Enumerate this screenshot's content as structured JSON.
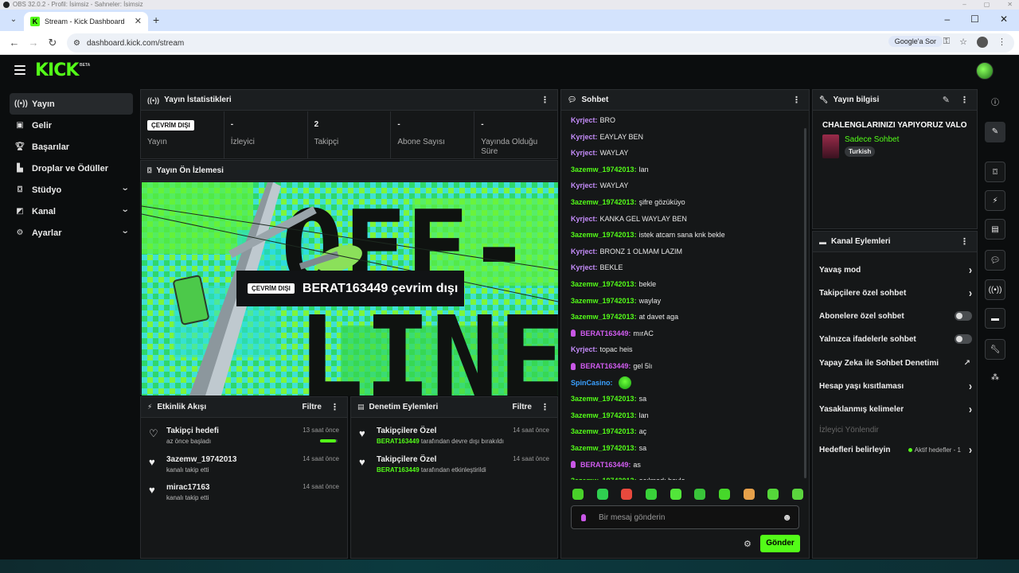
{
  "os": {
    "title": "OBS 32.0.2 - Profil: İsimsiz - Sahneler: İsimsiz"
  },
  "browser": {
    "tab_title": "Stream - Kick Dashboard",
    "url": "dashboard.kick.com/stream",
    "ask_google": "Google'a Sor"
  },
  "app": {
    "logo": "KICK",
    "beta": "BETA"
  },
  "sidebar": {
    "items": [
      {
        "label": "Yayın",
        "icon": "stream-icon"
      },
      {
        "label": "Gelir",
        "icon": "revenue-icon"
      },
      {
        "label": "Başarılar",
        "icon": "trophy-icon"
      },
      {
        "label": "Droplar ve Ödüller",
        "icon": "drops-icon"
      },
      {
        "label": "Stüdyo",
        "icon": "studio-icon"
      },
      {
        "label": "Kanal",
        "icon": "channel-icon"
      },
      {
        "label": "Ayarlar",
        "icon": "settings-icon"
      }
    ]
  },
  "stats": {
    "title": "Yayın İstatistikleri",
    "offline_badge": "ÇEVRİM DIŞI",
    "items": [
      {
        "value": "",
        "label": "Yayın"
      },
      {
        "value": "-",
        "label": "İzleyici"
      },
      {
        "value": "2",
        "label": "Takipçi"
      },
      {
        "value": "-",
        "label": "Abone Sayısı"
      },
      {
        "value": "-",
        "label": "Yayında Olduğu Süre"
      }
    ]
  },
  "preview": {
    "title": "Yayın Ön İzlemesi",
    "badge": "ÇEVRİM DIŞI",
    "status_text": "BERAT163449 çevrim dışı",
    "art_text_1": "OFF-",
    "art_text_2": "LINE"
  },
  "events": {
    "title": "Etkinlik Akışı",
    "filter": "Filtre",
    "items": [
      {
        "title": "Takipçi hedefi",
        "sub": "az önce başladı",
        "time": "13 saat önce",
        "progress": 0.9
      },
      {
        "title": "3azemw_19742013",
        "sub": "kanalı takip etti",
        "time": "14 saat önce"
      },
      {
        "title": "mirac17163",
        "sub": "kanalı takip etti",
        "time": "14 saat önce"
      }
    ]
  },
  "moderation": {
    "title": "Denetim Eylemleri",
    "filter": "Filtre",
    "items": [
      {
        "title": "Takipçilere Özel",
        "user": "BERAT163449",
        "sub": "tarafından devre dışı bırakıldı",
        "time": "14 saat önce"
      },
      {
        "title": "Takipçilere Özel",
        "user": "BERAT163449",
        "sub": "tarafından etkinleştirildi",
        "time": "14 saat önce"
      }
    ]
  },
  "chat": {
    "title": "Sohbet",
    "messages": [
      {
        "user": "Kyrject:",
        "color": "#c58dfb",
        "text": "BRO"
      },
      {
        "user": "Kyrject:",
        "color": "#c58dfb",
        "text": "EAYLAY BEN"
      },
      {
        "user": "Kyrject:",
        "color": "#c58dfb",
        "text": "WAYLAY"
      },
      {
        "user": "3azemw_19742013:",
        "color": "#53fc18",
        "text": "lan"
      },
      {
        "user": "Kyrject:",
        "color": "#c58dfb",
        "text": "WAYLAY"
      },
      {
        "user": "3azemw_19742013:",
        "color": "#53fc18",
        "text": "şifre gözüküyo"
      },
      {
        "user": "Kyrject:",
        "color": "#c58dfb",
        "text": "KANKA GEL WAYLAY BEN"
      },
      {
        "user": "3azemw_19742013:",
        "color": "#53fc18",
        "text": "istek atcam sana knk bekle"
      },
      {
        "user": "Kyrject:",
        "color": "#c58dfb",
        "text": "BRONZ 1 OLMAM LAZIM"
      },
      {
        "user": "Kyrject:",
        "color": "#c58dfb",
        "text": "BEKLE"
      },
      {
        "user": "3azemw_19742013:",
        "color": "#53fc18",
        "text": "bekle"
      },
      {
        "user": "3azemw_19742013:",
        "color": "#53fc18",
        "text": "waylay"
      },
      {
        "user": "3azemw_19742013:",
        "color": "#53fc18",
        "text": "at davet aga"
      },
      {
        "user": "BERAT163449:",
        "color": "#d15cf0",
        "text": "mırAC",
        "mic": true
      },
      {
        "user": "Kyrject:",
        "color": "#c58dfb",
        "text": "topac heis"
      },
      {
        "user": "BERAT163449:",
        "color": "#d15cf0",
        "text": "gel 5lı",
        "mic": true
      },
      {
        "user": "SpinCasino:",
        "color": "#3aa0ff",
        "text": "",
        "emote": true
      },
      {
        "user": "3azemw_19742013:",
        "color": "#53fc18",
        "text": "sa"
      },
      {
        "user": "3azemw_19742013:",
        "color": "#53fc18",
        "text": "lan"
      },
      {
        "user": "3azemw_19742013:",
        "color": "#53fc18",
        "text": "aç"
      },
      {
        "user": "3azemw_19742013:",
        "color": "#53fc18",
        "text": "sa"
      },
      {
        "user": "BERAT163449:",
        "color": "#d15cf0",
        "text": "as",
        "mic": true
      },
      {
        "user": "3azemw_19742013:",
        "color": "#53fc18",
        "text": "açılmadı hayla"
      }
    ],
    "emote_colors": [
      "#49d12a",
      "#2fcf50",
      "#e8493d",
      "#39d13a",
      "#52e63a",
      "#39c43a",
      "#46d82a",
      "#e6a14a",
      "#55d63a",
      "#5bd43e"
    ],
    "input_placeholder": "Bir mesaj gönderin",
    "send": "Gönder"
  },
  "info": {
    "title": "Yayın bilgisi",
    "stream_title": "CHALENGLARINIZI YAPIYORUZ VALO",
    "category": "Sadece Sohbet",
    "language": "Turkish"
  },
  "actions": {
    "title": "Kanal Eylemleri",
    "items": [
      {
        "label": "Yavaş mod",
        "kind": "chevron"
      },
      {
        "label": "Takipçilere özel sohbet",
        "kind": "chevron"
      },
      {
        "label": "Abonelere özel sohbet",
        "kind": "toggle"
      },
      {
        "label": "Yalnızca ifadelerle sohbet",
        "kind": "toggle"
      },
      {
        "label": "Yapay Zeka ile Sohbet Denetimi",
        "kind": "external"
      },
      {
        "label": "Hesap yaşı kısıtlaması",
        "kind": "chevron"
      },
      {
        "label": "Yasaklanmış kelimeler",
        "kind": "chevron"
      },
      {
        "label": "İzleyici Yönlendir",
        "kind": "disabled"
      },
      {
        "label": "Hedefleri belirleyin",
        "kind": "chevron",
        "tag": "Aktif hedefler - 1"
      }
    ]
  },
  "rail": {
    "icons": [
      "info-icon",
      "edit-icon",
      "scan-icon",
      "bolt-icon",
      "document-icon",
      "chat-icon",
      "broadcast-icon",
      "layout-icon",
      "wrench-icon",
      "nodes-icon"
    ]
  },
  "colors": {
    "brand": "#53fc18",
    "background": "#0b0d0e",
    "panel": "#151718"
  }
}
